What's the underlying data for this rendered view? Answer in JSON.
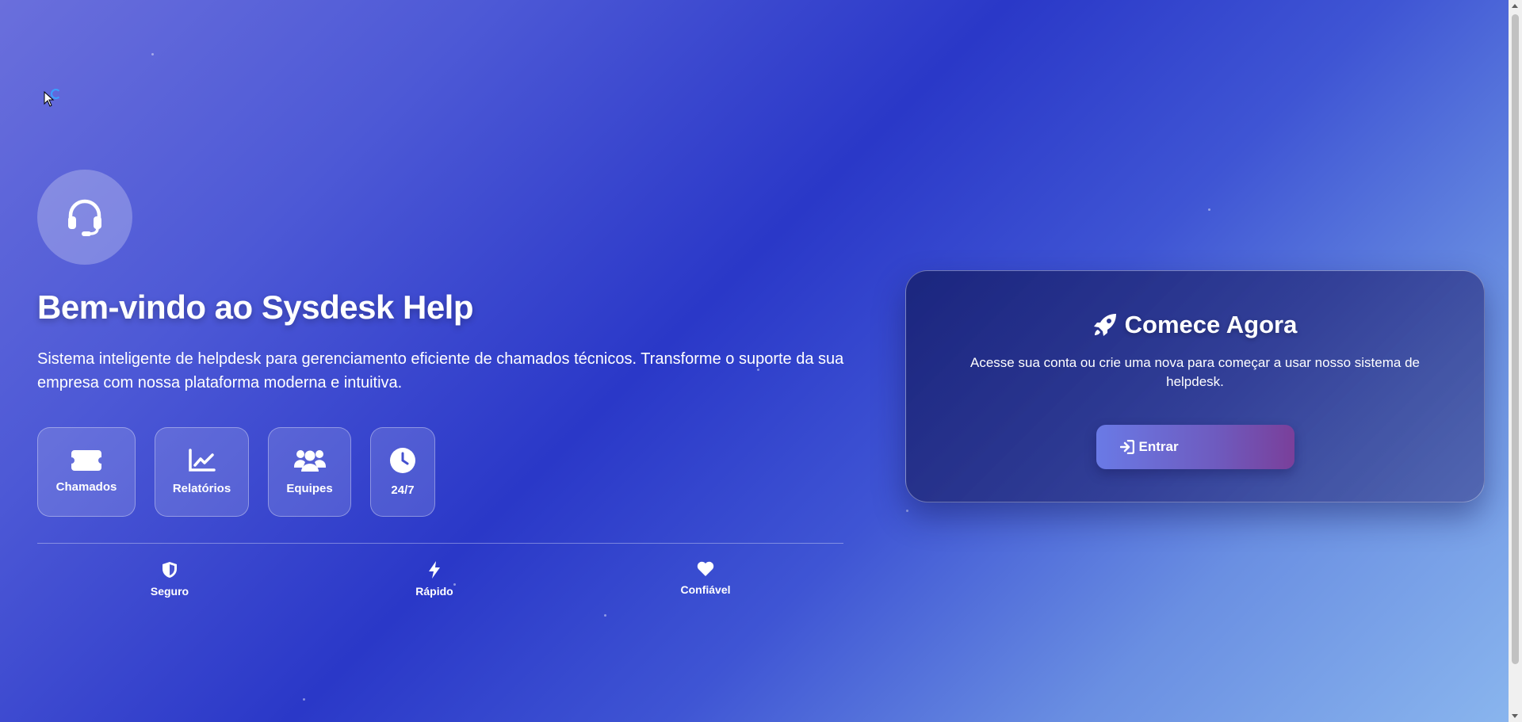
{
  "hero": {
    "icon": "headset-icon",
    "title": "Bem-vindo ao Sysdesk Help",
    "subtitle": "Sistema inteligente de helpdesk para gerenciamento eficiente de chamados técnicos. Transforme o suporte da sua empresa com nossa plataforma moderna e intuitiva."
  },
  "features": [
    {
      "label": "Chamados",
      "icon": "ticket-icon"
    },
    {
      "label": "Relatórios",
      "icon": "chart-line-icon"
    },
    {
      "label": "Equipes",
      "icon": "users-icon"
    },
    {
      "label": "24/7",
      "icon": "clock-icon"
    }
  ],
  "badges": [
    {
      "label": "Seguro",
      "icon": "shield-icon"
    },
    {
      "label": "Rápido",
      "icon": "bolt-icon"
    },
    {
      "label": "Confiável",
      "icon": "heart-icon"
    }
  ],
  "card": {
    "icon": "rocket-icon",
    "title": "Comece Agora",
    "text": "Acesse sua conta ou crie uma nova para começar a usar nosso sistema de helpdesk.",
    "button_label": "Entrar",
    "button_icon": "sign-in-icon"
  },
  "colors": {
    "background_start": "#6a6fdc",
    "background_mid": "#2a38c8",
    "background_end": "#8ab6ee",
    "button_start": "#6a7ae6",
    "button_end": "#7a3f9a"
  }
}
